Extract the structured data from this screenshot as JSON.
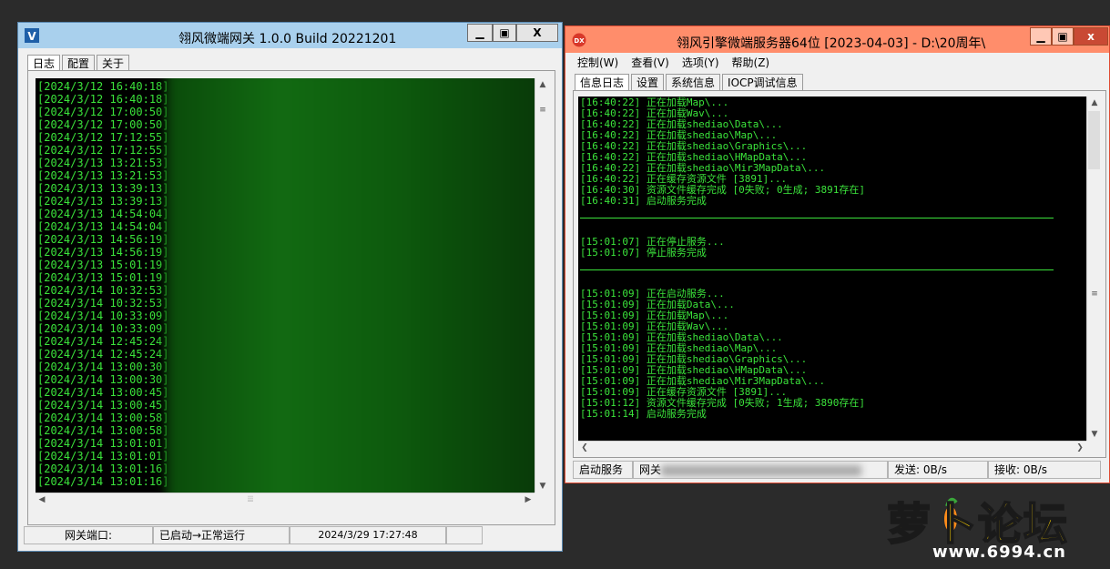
{
  "gateway": {
    "title": "翎风微端网关 1.0.0 Build 20221201",
    "icon": "v-logo-icon",
    "tabs": [
      "日志",
      "配置",
      "关于"
    ],
    "log_lines": [
      "[2024/3/12 16:40:18]",
      "[2024/3/12 16:40:18]",
      "[2024/3/12 17:00:50]",
      "[2024/3/12 17:00:50]",
      "[2024/3/12 17:12:55]",
      "[2024/3/12 17:12:55]",
      "[2024/3/13 13:21:53]",
      "[2024/3/13 13:21:53]",
      "[2024/3/13 13:39:13]",
      "[2024/3/13 13:39:13]",
      "[2024/3/13 14:54:04]",
      "[2024/3/13 14:54:04]",
      "[2024/3/13 14:56:19]",
      "[2024/3/13 14:56:19]",
      "[2024/3/13 15:01:19]",
      "[2024/3/13 15:01:19]",
      "[2024/3/14 10:32:53]",
      "[2024/3/14 10:32:53]",
      "[2024/3/14 10:33:09]",
      "[2024/3/14 10:33:09]",
      "[2024/3/14 12:45:24]",
      "[2024/3/14 12:45:24]",
      "[2024/3/14 13:00:30]",
      "[2024/3/14 13:00:30]",
      "[2024/3/14 13:00:45]",
      "[2024/3/14 13:00:45]",
      "[2024/3/14 13:00:58]",
      "[2024/3/14 13:00:58]",
      "[2024/3/14 13:01:01]",
      "[2024/3/14 13:01:01]",
      "[2024/3/14 13:01:16]",
      "[2024/3/14 13:01:16]"
    ],
    "status": {
      "port_label": "网关端口:",
      "state": "已启动→正常运行",
      "datetime": "2024/3/29 17:27:48"
    },
    "hscroll_grip": "⦙⦙⦙"
  },
  "server": {
    "title": "翎风引擎微端服务器64位 [2023-04-03] - D:\\20周年\\",
    "icon": "dx-logo-icon",
    "menu": [
      "控制(W)",
      "查看(V)",
      "选项(Y)",
      "帮助(Z)"
    ],
    "tabs": [
      "信息日志",
      "设置",
      "系统信息",
      "IOCP调试信息"
    ],
    "log_block1": [
      "[16:40:22] 正在加载Map\\...",
      "[16:40:22] 正在加载Wav\\...",
      "[16:40:22] 正在加载shediao\\Data\\...",
      "[16:40:22] 正在加载shediao\\Map\\...",
      "[16:40:22] 正在加载shediao\\Graphics\\...",
      "[16:40:22] 正在加载shediao\\HMapData\\...",
      "[16:40:22] 正在加载shediao\\Mir3MapData\\...",
      "[16:40:22] 正在缓存资源文件 [3891]...",
      "[16:40:30] 资源文件缓存完成 [0失败; 0生成; 3891存在]",
      "[16:40:31] 启动服务完成"
    ],
    "log_block2": [
      "[15:01:07] 正在停止服务...",
      "[15:01:07] 停止服务完成"
    ],
    "log_block3": [
      "[15:01:09] 正在启动服务...",
      "[15:01:09] 正在加载Data\\...",
      "[15:01:09] 正在加载Map\\...",
      "[15:01:09] 正在加载Wav\\...",
      "[15:01:09] 正在加载shediao\\Data\\...",
      "[15:01:09] 正在加载shediao\\Map\\...",
      "[15:01:09] 正在加载shediao\\Graphics\\...",
      "[15:01:09] 正在加载shediao\\HMapData\\...",
      "[15:01:09] 正在加载shediao\\Mir3MapData\\...",
      "[15:01:09] 正在缓存资源文件 [3891]...",
      "[15:01:12] 资源文件缓存完成 [0失败; 1生成; 3890存在]",
      "[15:01:14] 启动服务完成"
    ],
    "status": {
      "service": "启动服务",
      "gateway": "网关",
      "send": "发送: 0B/s",
      "recv": "接收: 0B/s"
    }
  },
  "watermark": {
    "title": "萝卜论坛",
    "url": "www.6994.cn"
  },
  "colors": {
    "console_text": "#3be33b",
    "gateway_title": "#a9d0ed",
    "server_title": "#ff8d6b"
  }
}
